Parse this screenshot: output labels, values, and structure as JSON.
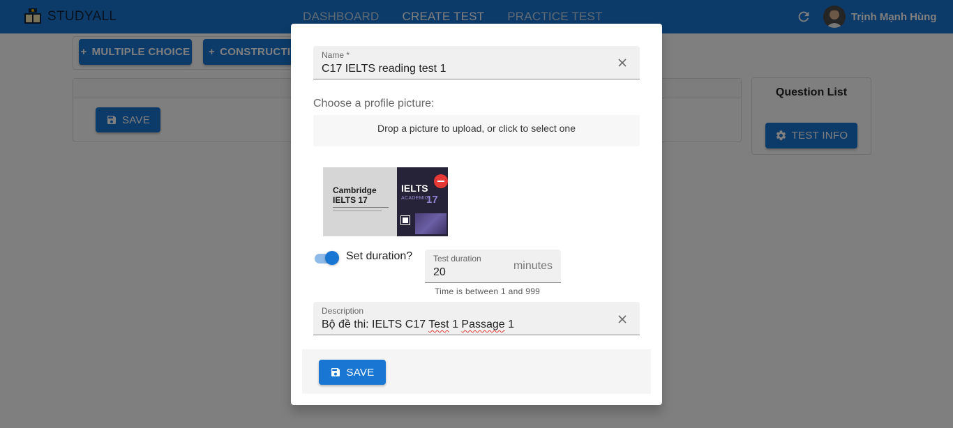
{
  "app": {
    "brand": "STUDYALL",
    "nav": [
      "DASHBOARD",
      "CREATE TEST",
      "PRACTICE TEST"
    ],
    "active_nav": "CREATE TEST",
    "user_name": "Trịnh Mạnh Hùng",
    "accent_color": "#1976d2"
  },
  "background": {
    "multiple_choice_label": "MULTIPLE CHOICE",
    "constructive_label": "CONSTRUCTIVE",
    "save_label": "SAVE",
    "question_list_title": "Question List",
    "test_info_label": "TEST INFO"
  },
  "dialog": {
    "name_label": "Name *",
    "name_value": "C17 IELTS reading test 1",
    "profile_picture_label": "Choose a profile picture:",
    "dropzone_text": "Drop a picture to upload, or click to select one",
    "cover": {
      "title_line1": "Cambridge",
      "title_line2": "IELTS 17",
      "ielts": "IELTS",
      "academic": "ACADEMIC",
      "number": "17"
    },
    "set_duration_label": "Set duration?",
    "set_duration_on": true,
    "duration_label": "Test duration",
    "duration_value": "20",
    "duration_unit": "minutes",
    "duration_helper": "Time is between 1 and 999",
    "description_label": "Description",
    "description_prefix": "Bộ đề thi: IELTS C17 ",
    "description_test": "Test",
    "description_mid": " 1 ",
    "description_passage": "Passage",
    "description_suffix": " 1",
    "save_label": "SAVE"
  },
  "icons": [
    "book-logo-icon",
    "plus-icon",
    "save-icon",
    "gear-icon",
    "refresh-icon",
    "close-icon",
    "remove-icon"
  ]
}
